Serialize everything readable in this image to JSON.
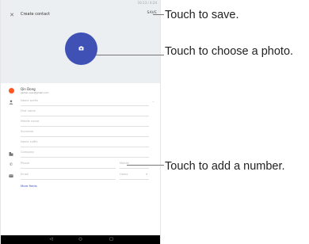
{
  "status_bar": {
    "time": "10:13 / 4:24"
  },
  "header": {
    "title": "Create contact",
    "save_label": "SAVE"
  },
  "account": {
    "name": "Qin Dong",
    "email": "jiaotai.user@gmail.com"
  },
  "fields": {
    "name_prefix": "Name prefix",
    "first_name": "First name",
    "middle_name": "Middle name",
    "surname": "Surname",
    "name_suffix": "Name suffix",
    "company": "Company",
    "phone": "Phone",
    "phone_type": "Mobile",
    "email": "Email",
    "email_type": "Home",
    "more_fields": "More fields"
  },
  "icons": {
    "close": "close-icon",
    "camera": "camera-icon",
    "person": "person-icon",
    "company": "business-icon",
    "phone": "phone-icon",
    "email": "email-icon",
    "nav": [
      "back-icon",
      "home-icon",
      "recents-icon"
    ]
  },
  "callouts": {
    "save": "Touch to save.",
    "photo": "Touch to choose a photo.",
    "number": "Touch to add a number."
  },
  "colors": {
    "accent": "#3f51b5",
    "account_dot": "#ff5722",
    "header_bg": "#eceff1",
    "nav_bg": "#000000"
  }
}
